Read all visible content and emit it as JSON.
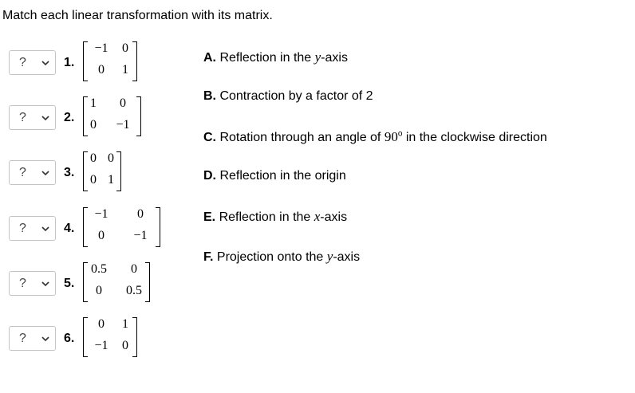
{
  "instruction": "Match each linear transformation with its matrix.",
  "questions": [
    {
      "select_value": "?",
      "number": "1.",
      "matrix": [
        [
          "−1",
          "0"
        ],
        [
          "0",
          "1"
        ]
      ]
    },
    {
      "select_value": "?",
      "number": "2.",
      "matrix": [
        [
          "1",
          "0"
        ],
        [
          "0",
          "−1"
        ]
      ]
    },
    {
      "select_value": "?",
      "number": "3.",
      "matrix": [
        [
          "0",
          "0"
        ],
        [
          "0",
          "1"
        ]
      ]
    },
    {
      "select_value": "?",
      "number": "4.",
      "matrix": [
        [
          "−1",
          "0"
        ],
        [
          "0",
          "−1"
        ]
      ]
    },
    {
      "select_value": "?",
      "number": "5.",
      "matrix": [
        [
          "0.5",
          "0"
        ],
        [
          "0",
          "0.5"
        ]
      ]
    },
    {
      "select_value": "?",
      "number": "6.",
      "matrix": [
        [
          "0",
          "1"
        ],
        [
          "−1",
          "0"
        ]
      ]
    }
  ],
  "options": [
    {
      "letter": "A.",
      "pre": " Reflection in the ",
      "math": "y",
      "post": "-axis"
    },
    {
      "letter": "B.",
      "pre": " Contraction by a factor of 2",
      "math": "",
      "post": ""
    },
    {
      "letter": "C.",
      "pre": " Rotation through an angle of ",
      "deg_value": "90",
      "deg_sup": "o",
      "post": " in the clockwise direction"
    },
    {
      "letter": "D.",
      "pre": " Reflection in the origin",
      "math": "",
      "post": ""
    },
    {
      "letter": "E.",
      "pre": " Reflection in the ",
      "math": "x",
      "post": "-axis"
    },
    {
      "letter": "F.",
      "pre": " Projection onto the ",
      "math": "y",
      "post": "-axis"
    }
  ]
}
